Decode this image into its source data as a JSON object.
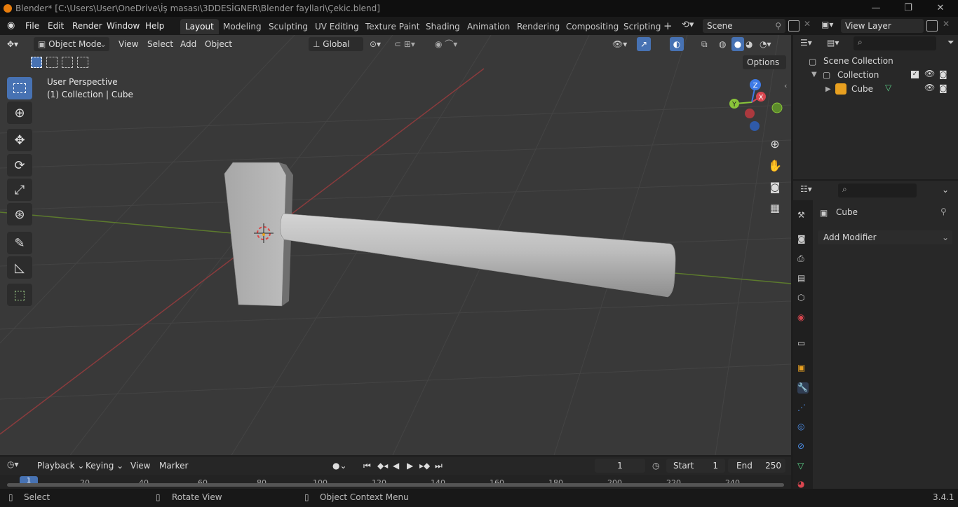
{
  "window": {
    "title": "Blender* [C:\\Users\\User\\OneDrive\\İş masası\\3DDESİGNER\\Blender fayllari\\Çekic.blend]"
  },
  "menu": [
    "File",
    "Edit",
    "Render",
    "Window",
    "Help"
  ],
  "workspaces": [
    "Layout",
    "Modeling",
    "Sculpting",
    "UV Editing",
    "Texture Paint",
    "Shading",
    "Animation",
    "Rendering",
    "Compositing",
    "Scripting"
  ],
  "scene": {
    "label": "Scene",
    "view_layer": "View Layer"
  },
  "viewport": {
    "mode": "Object Mode",
    "menus": [
      "View",
      "Select",
      "Add",
      "Object"
    ],
    "orientation": "Global",
    "options_label": "Options",
    "overlay_title": "User Perspective",
    "overlay_sub": "(1) Collection | Cube",
    "axes": {
      "x": "X",
      "y": "Y",
      "z": "Z"
    }
  },
  "outliner": {
    "scene_collection": "Scene Collection",
    "collection": "Collection",
    "object": "Cube"
  },
  "properties": {
    "object": "Cube",
    "add_modifier": "Add Modifier"
  },
  "timeline": {
    "menus": [
      "Playback",
      "Keying",
      "View",
      "Marker"
    ],
    "current_frame": "1",
    "start_label": "Start",
    "start": "1",
    "end_label": "End",
    "end": "250",
    "ticks": [
      "1",
      "20",
      "40",
      "60",
      "80",
      "100",
      "120",
      "140",
      "160",
      "180",
      "200",
      "220",
      "240"
    ]
  },
  "status": {
    "select": "Select",
    "rotate": "Rotate View",
    "context": "Object Context Menu",
    "version": "3.4.1"
  },
  "colors": {
    "accent": "#4772b3",
    "x_axis": "#d9464f",
    "y_axis": "#8ac53a",
    "z_axis": "#3e7ae6"
  }
}
